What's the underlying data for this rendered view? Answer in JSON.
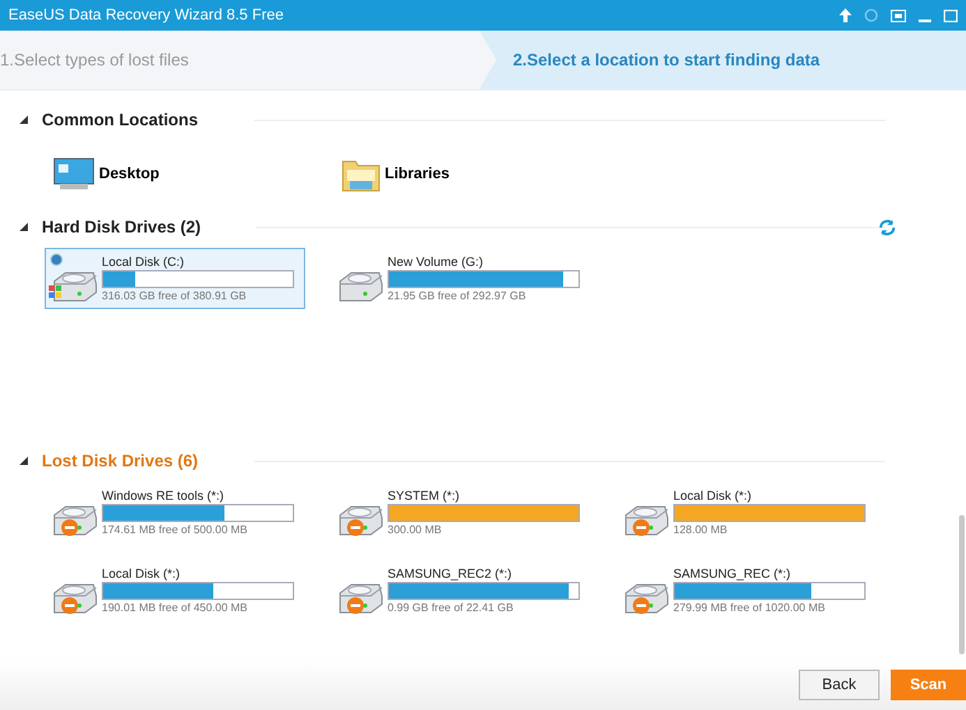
{
  "window": {
    "title": "EaseUS Data Recovery Wizard 8.5 Free"
  },
  "steps": [
    {
      "label": "1.Select types of lost files",
      "selected": false
    },
    {
      "label": "2.Select a location to start finding data",
      "selected": true
    }
  ],
  "common_locations": {
    "title": "Common Locations",
    "expanded": true,
    "items": [
      {
        "label": "Desktop",
        "kind": "desktop"
      },
      {
        "label": "Libraries",
        "kind": "libraries"
      }
    ]
  },
  "hard_disk_drives": {
    "title": "Hard Disk Drives (2)",
    "expanded": true,
    "drives": [
      {
        "name": "Local Disk (C:)",
        "info": "316.03 GB free of 380.91 GB",
        "level": 0.17,
        "color": "#2a9fd8",
        "kind": "system",
        "selected": true
      },
      {
        "name": "New Volume (G:)",
        "info": "21.95 GB free of 292.97 GB",
        "level": 0.92,
        "color": "#2a9fd8",
        "kind": "plain",
        "selected": false
      }
    ]
  },
  "lost_disk_drives": {
    "title": "Lost Disk Drives (6)",
    "expanded": true,
    "drives": [
      {
        "name": "Windows RE tools (*:)",
        "info": "174.61 MB free of 500.00 MB",
        "level": 0.64,
        "color": "#2a9fd8",
        "kind": "lost",
        "selected": false
      },
      {
        "name": "SYSTEM (*:)",
        "info": "300.00 MB",
        "level": 1,
        "color": "#f5a623",
        "kind": "lost",
        "selected": false
      },
      {
        "name": "Local Disk (*:)",
        "info": "128.00 MB",
        "level": 1,
        "color": "#f5a623",
        "kind": "lost",
        "selected": false
      },
      {
        "name": "Local Disk (*:)",
        "info": "190.01 MB free of 450.00 MB",
        "level": 0.58,
        "color": "#2a9fd8",
        "kind": "lost",
        "selected": false
      },
      {
        "name": "SAMSUNG_REC2 (*:)",
        "info": "0.99 GB free of 22.41 GB",
        "level": 0.95,
        "color": "#2a9fd8",
        "kind": "lost",
        "selected": false
      },
      {
        "name": "SAMSUNG_REC (*:)",
        "info": "279.99 MB free of 1020.00 MB",
        "level": 0.72,
        "color": "#2a9fd8",
        "kind": "lost",
        "selected": false
      }
    ]
  },
  "buttons": [
    {
      "label": "Back",
      "kind": "secondary"
    },
    {
      "label": "Scan",
      "kind": "primary"
    }
  ]
}
